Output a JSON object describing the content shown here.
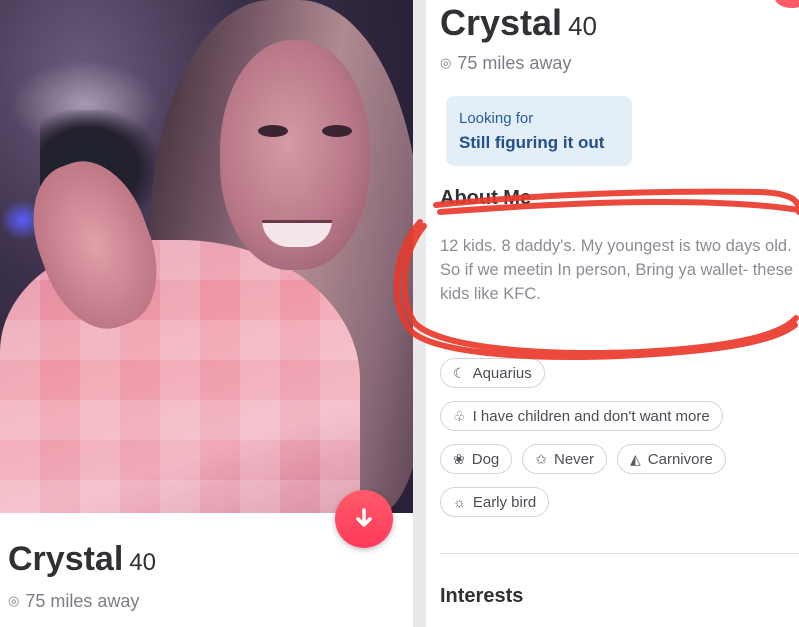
{
  "left_profile": {
    "name": "Crystal",
    "age": "40",
    "distance": "75 miles away",
    "pin_icon": "location-pin-icon",
    "fab_icon": "arrow-down-icon"
  },
  "right_profile": {
    "name": "Crystal",
    "age": "40",
    "distance": "75 miles away",
    "looking_for": {
      "label": "Looking for",
      "value": "Still figuring it out"
    },
    "about": {
      "heading": "About Me",
      "line1": "12 kids. 8 daddy's. My youngest is two days old.",
      "line2": "So if we meetin In person, Bring ya wallet- these kids like KFC."
    },
    "chips": [
      {
        "icon": "moon-icon",
        "label": "Aquarius"
      },
      {
        "icon": "baby-icon",
        "label": "I have children and don't want more"
      },
      {
        "icon": "paw-icon",
        "label": "Dog"
      },
      {
        "icon": "sparkle-icon",
        "label": "Never"
      },
      {
        "icon": "utensils-icon",
        "label": "Carnivore"
      },
      {
        "icon": "sunrise-icon",
        "label": "Early bird"
      }
    ],
    "interests_heading": "Interests"
  },
  "colors": {
    "accent": "#ff4458",
    "looking_bg": "#e4eef6",
    "looking_text": "#234f8a",
    "annotation": "#e8392a"
  }
}
